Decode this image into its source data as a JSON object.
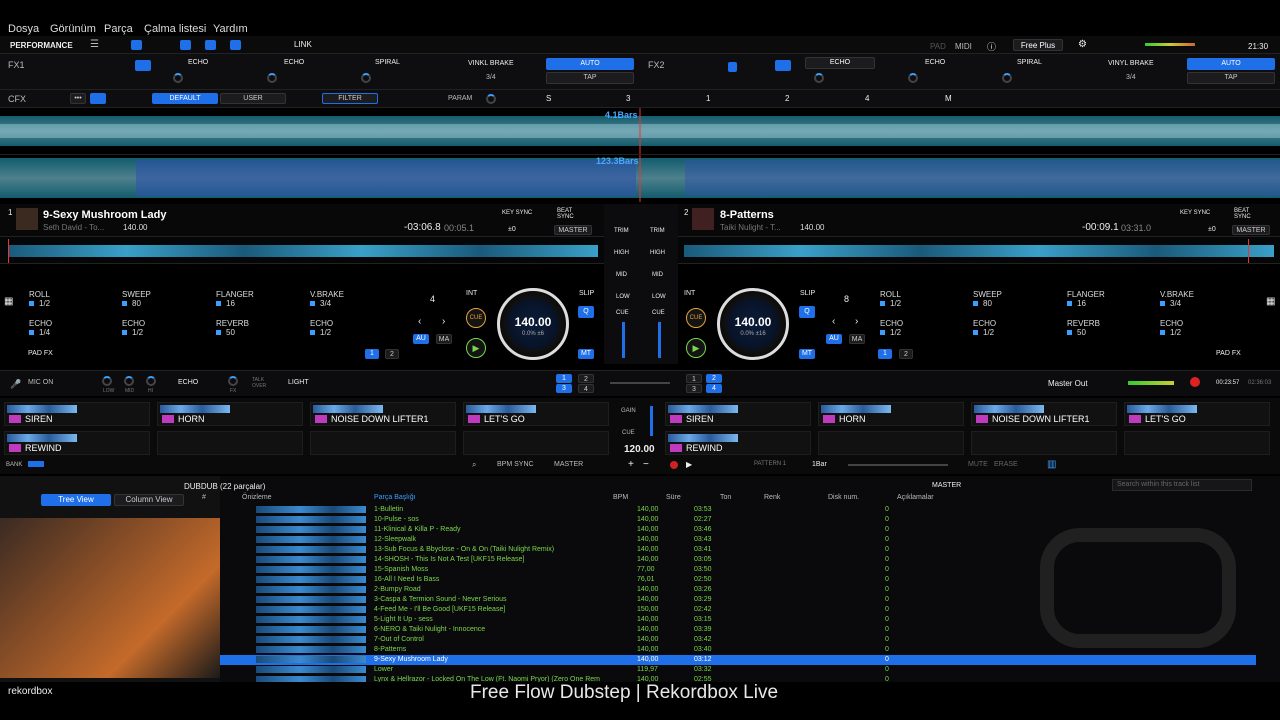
{
  "menu": [
    "Dosya",
    "Görünüm",
    "Parça",
    "Çalma listesi",
    "Yardım"
  ],
  "toolbar": {
    "mode": "PERFORMANCE",
    "link": "LINK",
    "pad": "PAD",
    "midi": "MIDI",
    "plan": "Free Plus",
    "clock": "21:30"
  },
  "fx": {
    "fx1": "FX1",
    "fx2": "FX2",
    "left": {
      "effects": [
        "ECHO",
        "ECHO",
        "SPIRAL"
      ],
      "brake": "VINKL BRAKE",
      "auto": "AUTO",
      "tap": "TAP",
      "beat": "3/4"
    },
    "right": {
      "effects": [
        "ECHO",
        "ECHO",
        "SPIRAL"
      ],
      "brake": "VINYL BRAKE",
      "auto": "AUTO",
      "tap": "TAP",
      "beat": "3/4"
    }
  },
  "cfx": {
    "label": "CFX",
    "default": "DEFAULT",
    "user": "USER",
    "filter": "FILTER",
    "param": "PARAM",
    "s": "S",
    "n3": "3",
    "n1": "1",
    "n2": "2",
    "n4": "4",
    "m": "M"
  },
  "waveform": {
    "bars1": "4.1Bars",
    "bars2": "123.3Bars"
  },
  "deck1": {
    "num": "1",
    "title": "9-Sexy Mushroom Lady",
    "artist": "Seth David - To...",
    "bpm": "140.00",
    "remain": "-03:06.8",
    "elapsed": "00:05.1",
    "keysync": "KEY SYNC",
    "beatsync": "BEAT SYNC",
    "master": "MASTER",
    "pm": "±0",
    "jogbpm": "140.00",
    "jogpct": "0.0% ±6",
    "loop": "4",
    "int": "INT",
    "cue": "CUE",
    "slip": "SLIP",
    "q": "Q",
    "au": "AU",
    "ma": "MA",
    "mt": "MT",
    "padfx": "PAD FX",
    "pads": [
      {
        "name": "ROLL",
        "val": "1/2"
      },
      {
        "name": "SWEEP",
        "val": "80"
      },
      {
        "name": "FLANGER",
        "val": "16"
      },
      {
        "name": "V.BRAKE",
        "val": "3/4"
      },
      {
        "name": "ECHO",
        "val": "1/4"
      },
      {
        "name": "ECHO",
        "val": "1/2"
      },
      {
        "name": "REVERB",
        "val": "50"
      },
      {
        "name": "ECHO",
        "val": "1/2"
      }
    ]
  },
  "deck2": {
    "num": "2",
    "title": "8-Patterns",
    "artist": "Taiki Nulight - T...",
    "bpm": "140.00",
    "remain": "-00:09.1",
    "elapsed": "03:31.0",
    "keysync": "KEY SYNC",
    "beatsync": "BEAT SYNC",
    "master": "MASTER",
    "pm": "±0",
    "jogbpm": "140.00",
    "jogpct": "0.0% ±16",
    "loop": "8",
    "int": "INT",
    "cue": "CUE",
    "slip": "SLIP",
    "q": "Q",
    "au": "AU",
    "ma": "MA",
    "mt": "MT",
    "padfx": "PAD FX",
    "pads": [
      {
        "name": "ROLL",
        "val": "1/2"
      },
      {
        "name": "SWEEP",
        "val": "80"
      },
      {
        "name": "FLANGER",
        "val": "16"
      },
      {
        "name": "V.BRAKE",
        "val": "3/4"
      },
      {
        "name": "ECHO",
        "val": "1/2"
      },
      {
        "name": "ECHO",
        "val": "1/2"
      },
      {
        "name": "REVERB",
        "val": "50"
      },
      {
        "name": "ECHO",
        "val": "1/2"
      }
    ]
  },
  "mixer": {
    "trim": "TRIM",
    "high": "HIGH",
    "mid": "MID",
    "low": "LOW",
    "cue": "CUE",
    "gain": "GAIN"
  },
  "micbar": {
    "mic": "MIC ON",
    "echo": "ECHO",
    "light": "LIGHT",
    "low": "LOW",
    "mid": "MID",
    "hi": "HI",
    "fx": "FX",
    "talk": "TALK OVER",
    "masterout": "Master Out",
    "time1": "00:23:57",
    "time2": "02:36:03"
  },
  "sampler": {
    "top": [
      "SIREN",
      "HORN",
      "NOISE DOWN LIFTER1",
      "LET'S GO",
      "SIREN",
      "HORN",
      "NOISE DOWN LIFTER1",
      "LET'S GO"
    ],
    "bottom": [
      "REWIND",
      "",
      "",
      "",
      "REWIND",
      "",
      "",
      ""
    ],
    "bank": "BANK",
    "bpmsync": "BPM SYNC",
    "master": "MASTER",
    "bpm": "120.00",
    "pattern": "PATTERN 1",
    "bar": "1Bar",
    "mute": "MUTE",
    "erase": "ERASE"
  },
  "browser": {
    "playlist": "DUBDUB (22 parçalar)",
    "treeview": "Tree View",
    "columnview": "Column View",
    "search_placeholder": "Search within this track list",
    "master": "MASTER",
    "cols": [
      "#",
      "Önizleme",
      "Parça Başlığı",
      "BPM",
      "Süre",
      "Ton",
      "Renk",
      "Disk num.",
      "Açıklamalar"
    ],
    "rows": [
      {
        "t": "1-Bulletin",
        "b": "140,00",
        "d": "03:53",
        "n": "0"
      },
      {
        "t": "10-Pulse - sos",
        "b": "140,00",
        "d": "02:27",
        "n": "0"
      },
      {
        "t": "11-Klinical & Killa P - Ready",
        "b": "140,00",
        "d": "03:46",
        "n": "0"
      },
      {
        "t": "12-Sleepwalk",
        "b": "140,00",
        "d": "03:43",
        "n": "0"
      },
      {
        "t": "13-Sub Focus & Bbyclose - On & On (Taiki Nulight Remix)",
        "b": "140,00",
        "d": "03:41",
        "n": "0"
      },
      {
        "t": "14-SHOSH - This Is Not A Test [UKF15 Release]",
        "b": "140,00",
        "d": "03:05",
        "n": "0"
      },
      {
        "t": "15-Spanish Moss",
        "b": "77,00",
        "d": "03:50",
        "n": "0"
      },
      {
        "t": "16-All I Need Is Bass",
        "b": "76,01",
        "d": "02:50",
        "n": "0"
      },
      {
        "t": "2-Bumpy Road",
        "b": "140,00",
        "d": "03:26",
        "n": "0"
      },
      {
        "t": "3-Caspa & Termion Sound - Never Serious",
        "b": "140,00",
        "d": "03:29",
        "n": "0"
      },
      {
        "t": "4-Feed Me - I'll Be Good [UKF15 Release]",
        "b": "150,00",
        "d": "02:42",
        "n": "0"
      },
      {
        "t": "5-Light It Up - sess",
        "b": "140,00",
        "d": "03:15",
        "n": "0"
      },
      {
        "t": "6-NERO & Taiki Nulight - Innocence",
        "b": "140,00",
        "d": "03:39",
        "n": "0"
      },
      {
        "t": "7-Out of Control",
        "b": "140,00",
        "d": "03:42",
        "n": "0"
      },
      {
        "t": "8-Patterns",
        "b": "140,00",
        "d": "03:40",
        "n": "0"
      },
      {
        "t": "9-Sexy Mushroom Lady",
        "b": "140,00",
        "d": "03:12",
        "n": "0",
        "sel": true
      },
      {
        "t": "Lower",
        "b": "119,97",
        "d": "03:32",
        "n": "0"
      },
      {
        "t": "Lynx & Hellrazor - Locked On The Low (Ft. Naomi Pryor) (Zero One Rem",
        "b": "140,00",
        "d": "02:55",
        "n": "0"
      }
    ]
  },
  "footer": {
    "logo": "rekordbox",
    "caption": "Free Flow Dubstep | Rekordbox Live"
  },
  "colors": {
    "accent": "#1e6fe8",
    "waveform": "#39c8e8",
    "green": "#7ad84a"
  }
}
